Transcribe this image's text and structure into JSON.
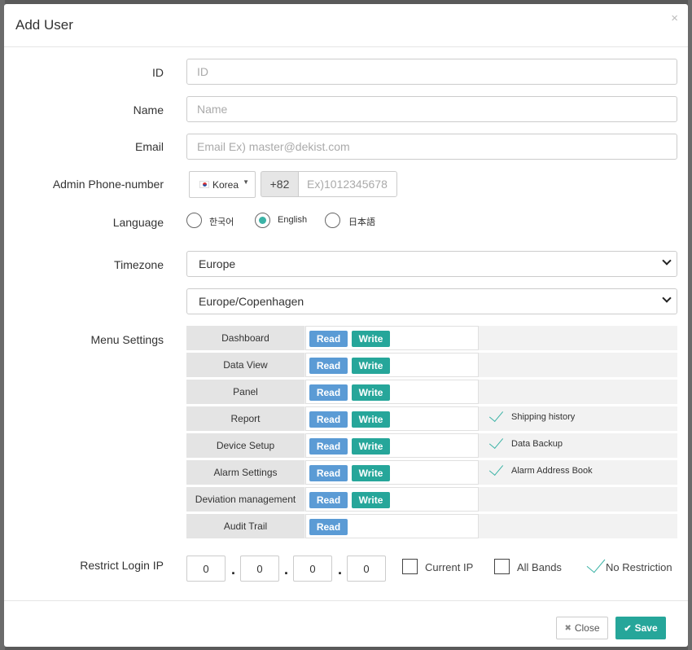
{
  "modal": {
    "title": "Add User",
    "close_glyph": "×"
  },
  "fields": {
    "id": {
      "label": "ID",
      "placeholder": "ID"
    },
    "name": {
      "label": "Name",
      "placeholder": "Name"
    },
    "email": {
      "label": "Email",
      "placeholder": "Email Ex) master@dekist.com"
    },
    "phone": {
      "label": "Admin Phone-number",
      "country": "Korea",
      "dial_code": "+82",
      "placeholder": "Ex)1012345678"
    },
    "language": {
      "label": "Language",
      "options": [
        "한국어",
        "English",
        "日本語"
      ],
      "selected": "English"
    },
    "timezone": {
      "label": "Timezone",
      "region": "Europe",
      "zone": "Europe/Copenhagen"
    }
  },
  "menu_settings": {
    "label": "Menu Settings",
    "read_label": "Read",
    "write_label": "Write",
    "rows": [
      {
        "name": "Dashboard",
        "extra": ""
      },
      {
        "name": "Data View",
        "extra": ""
      },
      {
        "name": "Panel",
        "extra": ""
      },
      {
        "name": "Report",
        "extra": "Shipping history"
      },
      {
        "name": "Device Setup",
        "extra": "Data Backup"
      },
      {
        "name": "Alarm Settings",
        "extra": "Alarm Address Book"
      },
      {
        "name": "Deviation management",
        "extra": ""
      },
      {
        "name": "Audit Trail",
        "extra": ""
      }
    ]
  },
  "restrict_ip": {
    "label": "Restrict Login IP",
    "octets": [
      "0",
      "0",
      "0",
      "0"
    ],
    "dot": ".",
    "options": [
      {
        "label": "Current IP",
        "checked": false
      },
      {
        "label": "All Bands",
        "checked": false
      },
      {
        "label": "No Restriction",
        "checked": true
      }
    ]
  },
  "footer": {
    "close_label": "Close",
    "save_label": "Save"
  },
  "colors": {
    "accent": "#26a69a",
    "read": "#5b9bd5"
  }
}
